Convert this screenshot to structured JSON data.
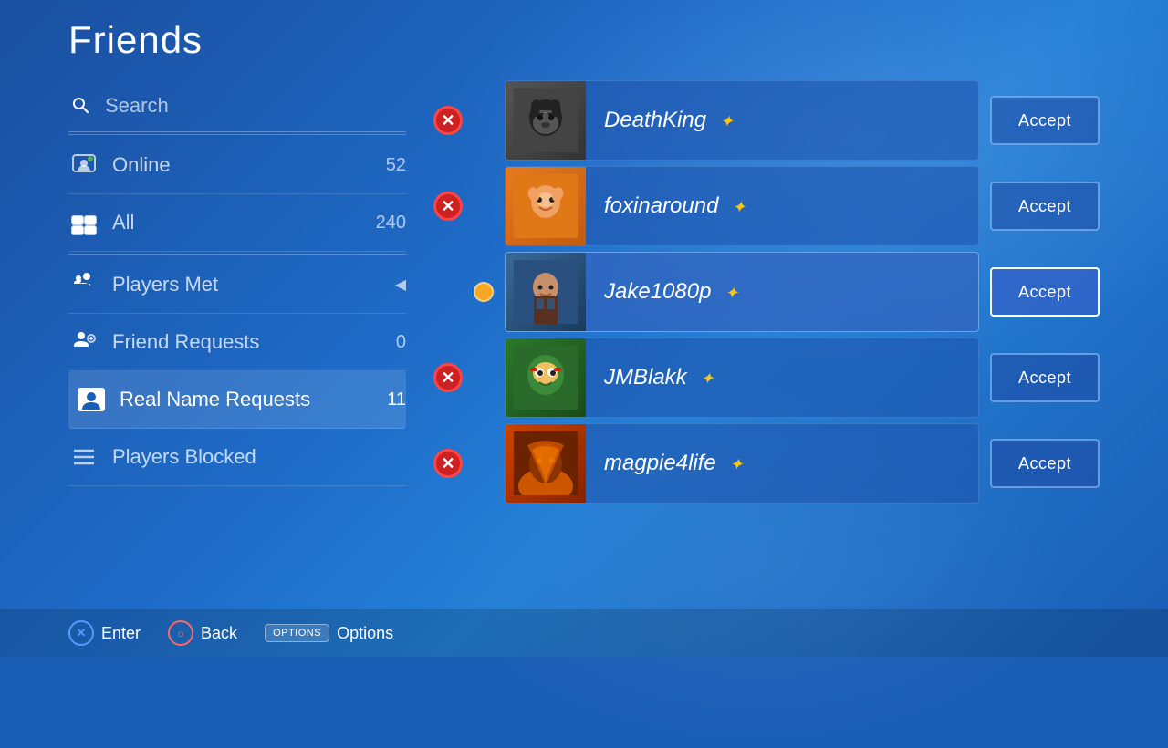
{
  "page": {
    "title": "Friends"
  },
  "sidebar": {
    "search_placeholder": "Search",
    "items": [
      {
        "id": "online",
        "label": "Online",
        "count": "52",
        "has_count": true,
        "selected": false
      },
      {
        "id": "all",
        "label": "All",
        "count": "240",
        "has_count": true,
        "selected": false
      },
      {
        "id": "players-met",
        "label": "Players Met",
        "count": "",
        "has_count": false,
        "selected": false,
        "has_arrow": true
      },
      {
        "id": "friend-requests",
        "label": "Friend Requests",
        "count": "0",
        "has_count": true,
        "selected": false
      },
      {
        "id": "real-name-requests",
        "label": "Real Name Requests",
        "count": "11",
        "has_count": true,
        "selected": true
      },
      {
        "id": "players-blocked",
        "label": "Players Blocked",
        "count": "",
        "has_count": false,
        "selected": false
      }
    ]
  },
  "friends": [
    {
      "id": 1,
      "name": "DeathKing",
      "has_plus": true,
      "has_remove": true,
      "has_status": false,
      "avatar_type": "dog",
      "focused": false
    },
    {
      "id": 2,
      "name": "foxinaround",
      "has_plus": true,
      "has_remove": true,
      "has_status": false,
      "avatar_type": "crash",
      "focused": false
    },
    {
      "id": 3,
      "name": "Jake1080p",
      "has_plus": true,
      "has_remove": false,
      "has_status": true,
      "avatar_type": "uncharted",
      "focused": true
    },
    {
      "id": 4,
      "name": "JMBlakk",
      "has_plus": true,
      "has_remove": true,
      "has_status": false,
      "avatar_type": "tmnt",
      "focused": false
    },
    {
      "id": 5,
      "name": "magpie4life",
      "has_plus": true,
      "has_remove": true,
      "has_status": false,
      "avatar_type": "fire",
      "focused": false
    }
  ],
  "buttons": {
    "accept_label": "Accept"
  },
  "footer": {
    "enter_label": "Enter",
    "back_label": "Back",
    "options_label": "Options",
    "options_btn_text": "OPTIONS"
  }
}
